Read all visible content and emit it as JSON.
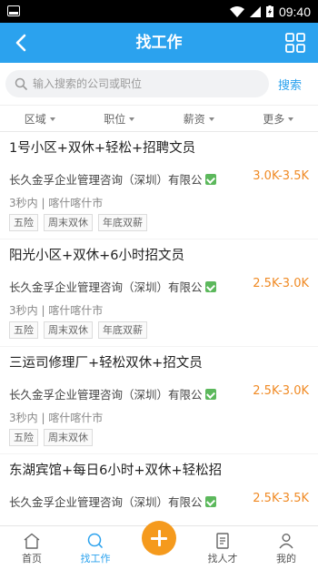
{
  "status": {
    "time": "09:40"
  },
  "header": {
    "title": "找工作"
  },
  "search": {
    "placeholder": "输入搜索的公司或职位",
    "button": "搜索"
  },
  "filters": [
    "区域",
    "职位",
    "薪资",
    "更多"
  ],
  "jobs": [
    {
      "title": "1号小区+双休+轻松+招聘文员",
      "company": "长久金孚企业管理咨询（深圳）有限公",
      "salary": "3.0K-3.5K",
      "meta": "3秒内 | 喀什喀什市",
      "tags": [
        "五险",
        "周末双休",
        "年底双薪"
      ]
    },
    {
      "title": "阳光小区+双休+6小时招文员",
      "company": "长久金孚企业管理咨询（深圳）有限公",
      "salary": "2.5K-3.0K",
      "meta": "3秒内 | 喀什喀什市",
      "tags": [
        "五险",
        "周末双休",
        "年底双薪"
      ]
    },
    {
      "title": "三运司修理厂+轻松双休+招文员",
      "company": "长久金孚企业管理咨询（深圳）有限公",
      "salary": "2.5K-3.0K",
      "meta": "3秒内 | 喀什喀什市",
      "tags": [
        "五险",
        "周末双休"
      ]
    },
    {
      "title": "东湖宾馆+每日6小时+双休+轻松招",
      "company": "长久金孚企业管理咨询（深圳）有限公",
      "salary": "2.5K-3.5K",
      "meta": "",
      "tags": []
    }
  ],
  "tabs": {
    "home": "首页",
    "jobs": "找工作",
    "talent": "找人才",
    "me": "我的"
  },
  "colors": {
    "primary": "#2ba2ee",
    "salary": "#f08a24",
    "fab": "#f59a1d"
  }
}
